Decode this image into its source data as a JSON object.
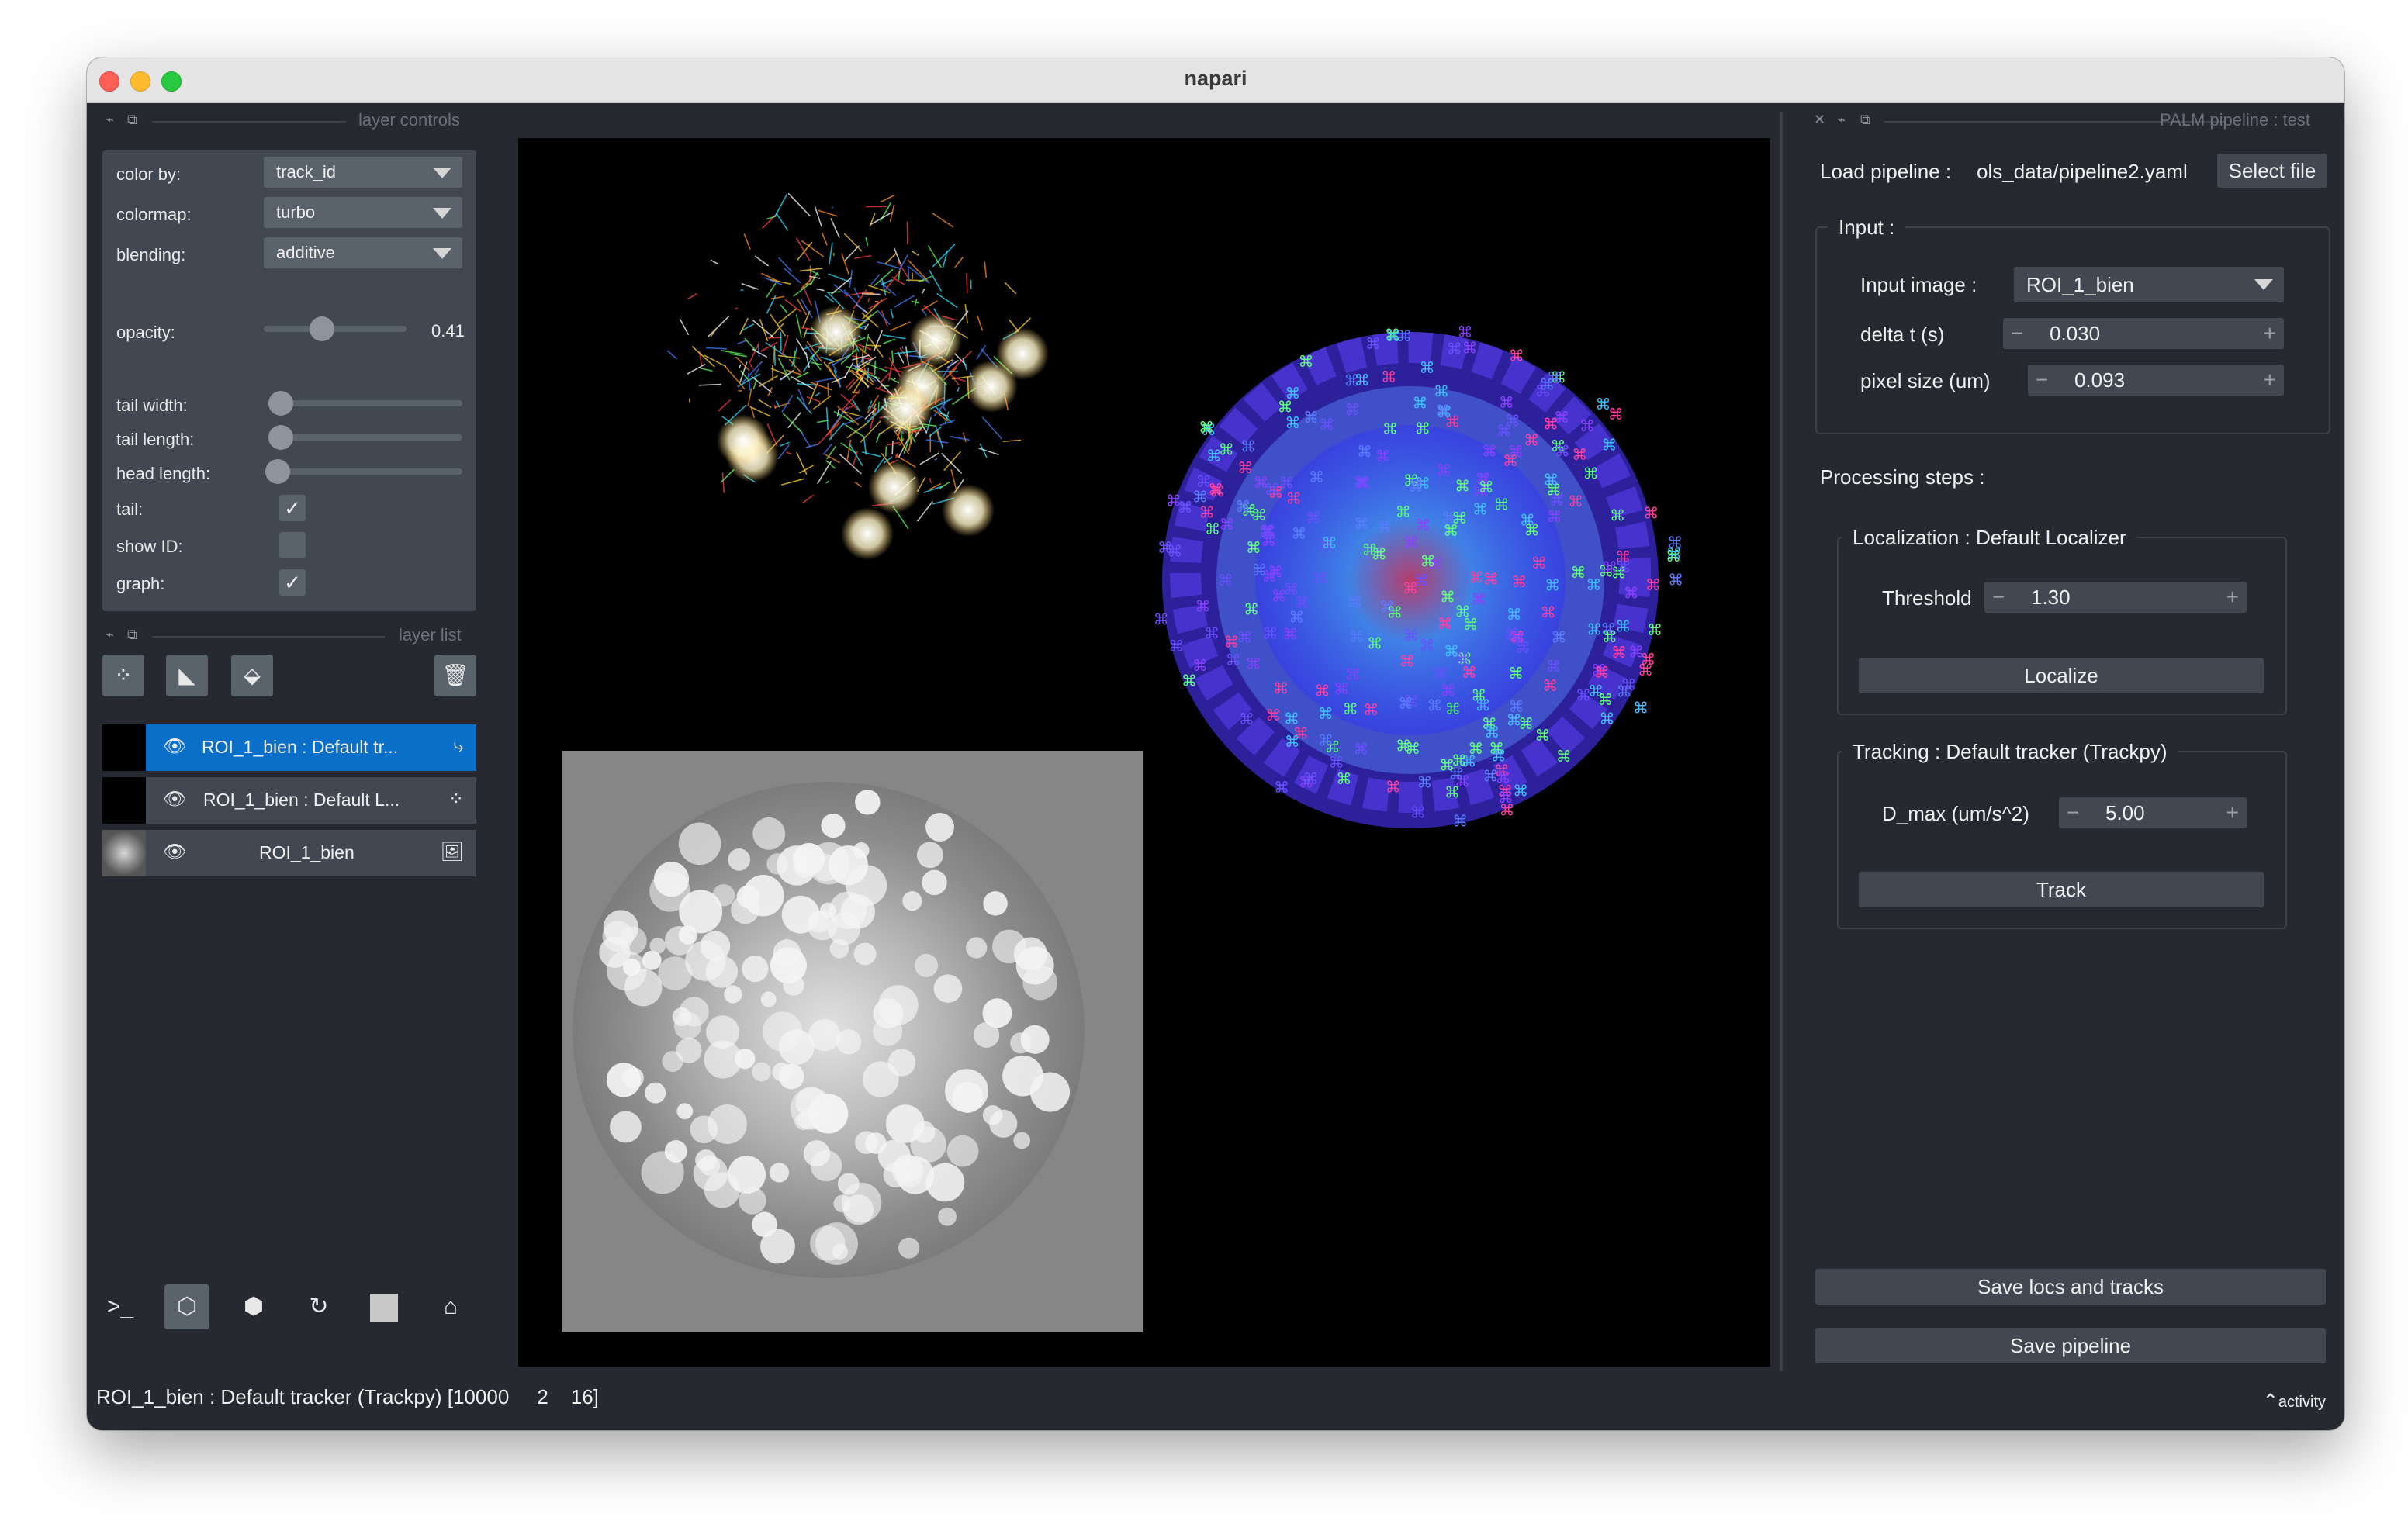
{
  "window": {
    "title": "napari"
  },
  "layer_controls": {
    "dock_title": "layer controls",
    "color_by": {
      "label": "color by:",
      "value": "track_id"
    },
    "colormap": {
      "label": "colormap:",
      "value": "turbo"
    },
    "blending": {
      "label": "blending:",
      "value": "additive"
    },
    "opacity": {
      "label": "opacity:",
      "value": "0.41",
      "fraction": 0.41
    },
    "tail_width": {
      "label": "tail width:",
      "fraction": 0.0
    },
    "tail_length": {
      "label": "tail length:",
      "fraction": 0.0
    },
    "head_length": {
      "label": "head length:",
      "fraction": 0.0
    },
    "tail": {
      "label": "tail:",
      "checked": true
    },
    "show_id": {
      "label": "show ID:",
      "checked": false
    },
    "graph": {
      "label": "graph:",
      "checked": true
    }
  },
  "layer_list": {
    "dock_title": "layer list",
    "tools": [
      "new-points-icon",
      "new-shapes-icon",
      "new-labels-icon",
      "delete-layer-icon"
    ],
    "layers": [
      {
        "name": "ROI_1_bien : Default tr...",
        "type_icon": "tracks-icon",
        "selected": true
      },
      {
        "name": "ROI_1_bien : Default L...",
        "type_icon": "points-icon",
        "selected": false
      },
      {
        "name": "ROI_1_bien",
        "type_icon": "image-icon",
        "selected": false
      }
    ]
  },
  "viewer_buttons": [
    "console-icon",
    "ndisplay-icon",
    "roll-dims-icon",
    "transpose-icon",
    "grid-icon",
    "home-icon"
  ],
  "status": {
    "text": "ROI_1_bien : Default tracker (Trackpy) [10000     2    16]",
    "activity": "activity"
  },
  "palm": {
    "dock_title": "PALM pipeline : test",
    "load_label": "Load pipeline :",
    "load_path": "ols_data/pipeline2.yaml",
    "select_file": "Select file",
    "input_title": "Input :",
    "input_image_label": "Input image :",
    "input_image_value": "ROI_1_bien",
    "delta_t_label": "delta t (s)",
    "delta_t_value": "0.030",
    "pixel_size_label": "pixel size (um)",
    "pixel_size_value": "0.093",
    "processing_title": "Processing steps :",
    "localization_title": "Localization : Default Localizer",
    "threshold_label": "Threshold",
    "threshold_value": "1.30",
    "localize_button": "Localize",
    "tracking_title": "Tracking : Default tracker (Trackpy)",
    "dmax_label": "D_max (um/s^2)",
    "dmax_value": "5.00",
    "track_button": "Track",
    "save_locs_button": "Save locs and tracks",
    "save_pipeline_button": "Save pipeline"
  },
  "colors": {
    "window_bg": "#262930",
    "panel_bg": "#414851",
    "selected": "#0a6fc8",
    "canvas": "#000000"
  }
}
